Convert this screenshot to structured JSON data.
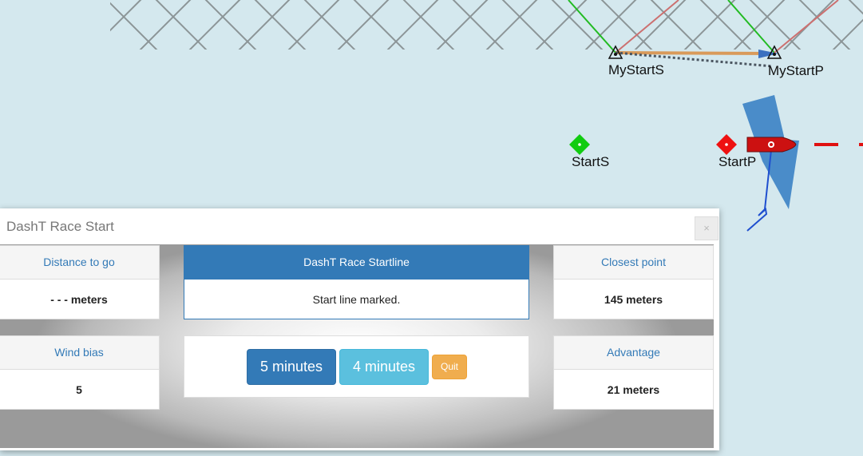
{
  "map": {
    "labels": {
      "my_start_s": "MyStartS",
      "my_start_p": "MyStartP",
      "start_s": "StartS",
      "start_p": "StartP"
    },
    "colors": {
      "sea": "#d4e8ee",
      "start_s_mark": "#11cc11",
      "start_p_mark": "#ee1111",
      "boat": "#cc1111",
      "wind_sector": "#3b82c4",
      "course_line": "#e01010"
    }
  },
  "dialog": {
    "title": "DashT Race Start",
    "close_label": "×",
    "distance": {
      "label": "Distance to go",
      "value": "- - - meters"
    },
    "startline": {
      "label": "DashT Race Startline",
      "status": "Start line marked."
    },
    "closest": {
      "label": "Closest point",
      "value": "145 meters"
    },
    "wind_bias": {
      "label": "Wind bias",
      "value": "5"
    },
    "advantage": {
      "label": "Advantage",
      "value": "21 meters"
    },
    "buttons": {
      "five_minutes": "5 minutes",
      "four_minutes": "4 minutes",
      "quit": "Quit"
    }
  }
}
